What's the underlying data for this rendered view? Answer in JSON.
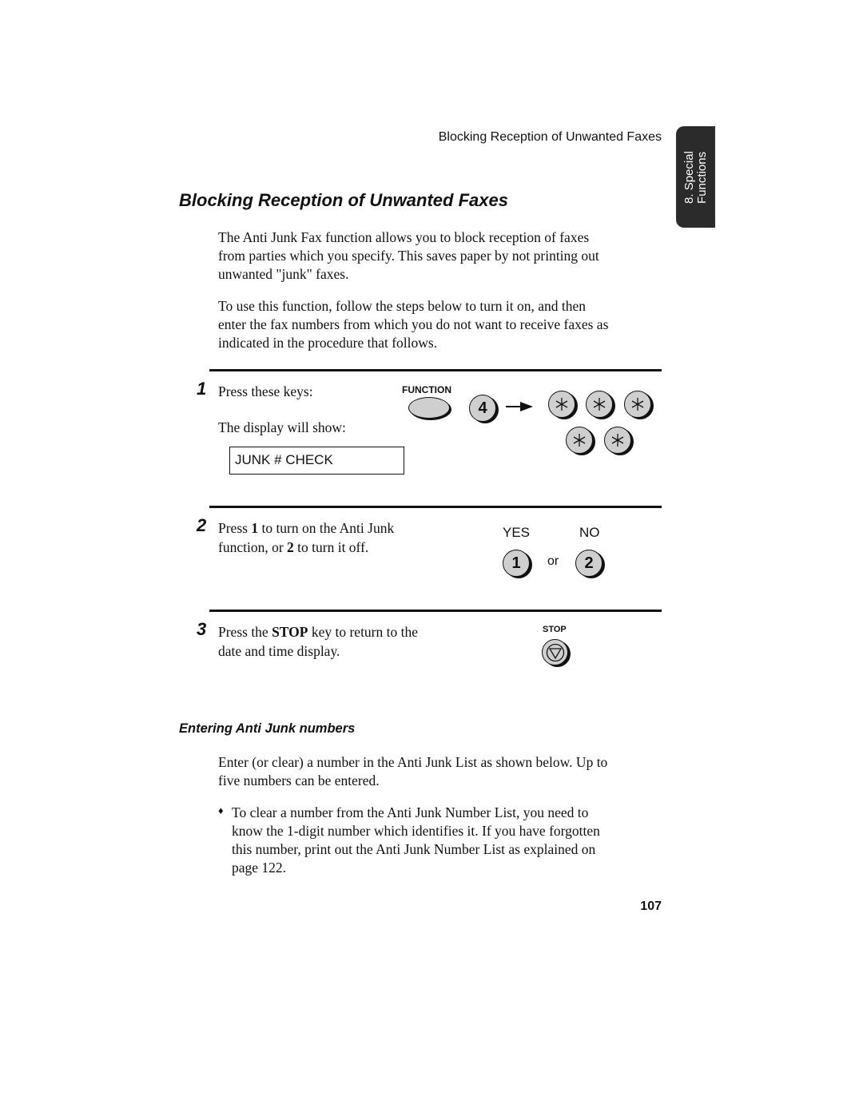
{
  "header": {
    "running_title": "Blocking Reception of Unwanted Faxes",
    "side_tab": {
      "line1": "8. Special",
      "line2": "Functions"
    }
  },
  "title": "Blocking Reception of Unwanted Faxes",
  "intro": {
    "paragraph1": [
      "The Anti Junk Fax function allows you to block reception of faxes",
      "from parties which you specify. This saves paper by not printing out",
      "unwanted \"junk\" faxes."
    ],
    "paragraph2": [
      "To use this function, follow the steps below to turn it on, and then",
      "enter the fax numbers from which you do not want to receive faxes as",
      "indicated in the procedure that follows."
    ]
  },
  "steps": [
    {
      "number": "1",
      "text_line1": "Press these keys:",
      "text_line2": "The display will show:",
      "display": "JUNK # CHECK",
      "keys": {
        "function_label": "FUNCTION",
        "digit": "4",
        "star": "*",
        "arrow": "arrow-right-icon"
      }
    },
    {
      "number": "2",
      "line1_pre": "Press ",
      "line1_bold": "1",
      "line1_post": " to turn on the Anti Junk",
      "line2_pre": "function, or ",
      "line2_bold": "2",
      "line2_post": " to turn it off.",
      "yes_label": "YES",
      "no_label": "NO",
      "yes_key": "1",
      "no_key": "2",
      "or_label": "or"
    },
    {
      "number": "3",
      "line1_pre": "Press the ",
      "line1_bold": "STOP",
      "line1_post": " key to return to the",
      "line2": "date and time display.",
      "stop_label": "STOP"
    }
  ],
  "section": {
    "heading": "Entering Anti Junk numbers",
    "paragraph": [
      "Enter (or clear) a number in the Anti Junk List as shown below. Up to",
      "five numbers can be entered."
    ],
    "bullet_symbol": "♦",
    "bullet": [
      "To clear a number from the Anti Junk Number List, you need to",
      "know the 1-digit number which identifies it. If you have forgotten",
      "this number, print out the Anti Junk Number List as explained on",
      "page 122."
    ]
  },
  "page_number": "107"
}
